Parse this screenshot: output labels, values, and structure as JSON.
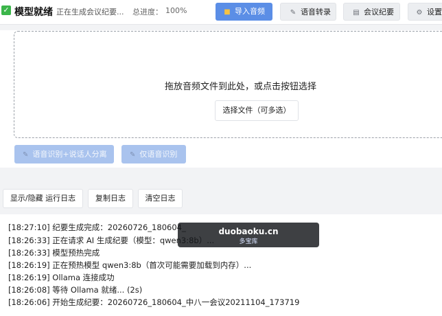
{
  "header": {
    "status_title": "模型就绪",
    "status_text": "正在生成会议纪要...",
    "progress_label": "总进度：",
    "progress_value": "100%",
    "buttons": {
      "import_audio": "导入音频",
      "speech_to_text": "语音转录",
      "meeting_minutes": "会议纪要",
      "settings": "设置"
    }
  },
  "drop_zone": {
    "hint": "拖放音频文件到此处，或点击按钮选择",
    "choose_button": "选择文件（可多选）"
  },
  "actions": {
    "diarize": "语音识别+说话人分离",
    "asr_only": "仅语音识别"
  },
  "log_toolbar": {
    "toggle": "显示/隐藏 运行日志",
    "copy": "复制日志",
    "clear": "清空日志"
  },
  "log": [
    "[18:27:10] 纪要生成完成：20260726_180604_",
    "[18:26:33] 正在请求 AI 生成纪要（模型：qwen3:8b）...",
    "[18:26:33] 模型预热完成",
    "[18:26:19] 正在预热模型 qwen3:8b（首次可能需要加载到内存）...",
    "[18:26:19] Ollama 连接成功",
    "[18:26:08] 等待 Ollama 就绪... (2s)",
    "[18:26:06] 开始生成纪要：20260726_180604_中八一会议20211104_173719"
  ],
  "watermark": {
    "main": "duobaoku.cn",
    "sub": "多宝库"
  },
  "icons": {
    "status": "check-square-icon",
    "import": "folder-icon",
    "asr": "pencil-icon",
    "minutes": "clipboard-icon",
    "settings": "gear-icon",
    "action": "microphone-icon"
  },
  "colors": {
    "primary": "#5b8ee6",
    "primary_disabled": "#a9c3ee",
    "success": "#3bb54a"
  }
}
